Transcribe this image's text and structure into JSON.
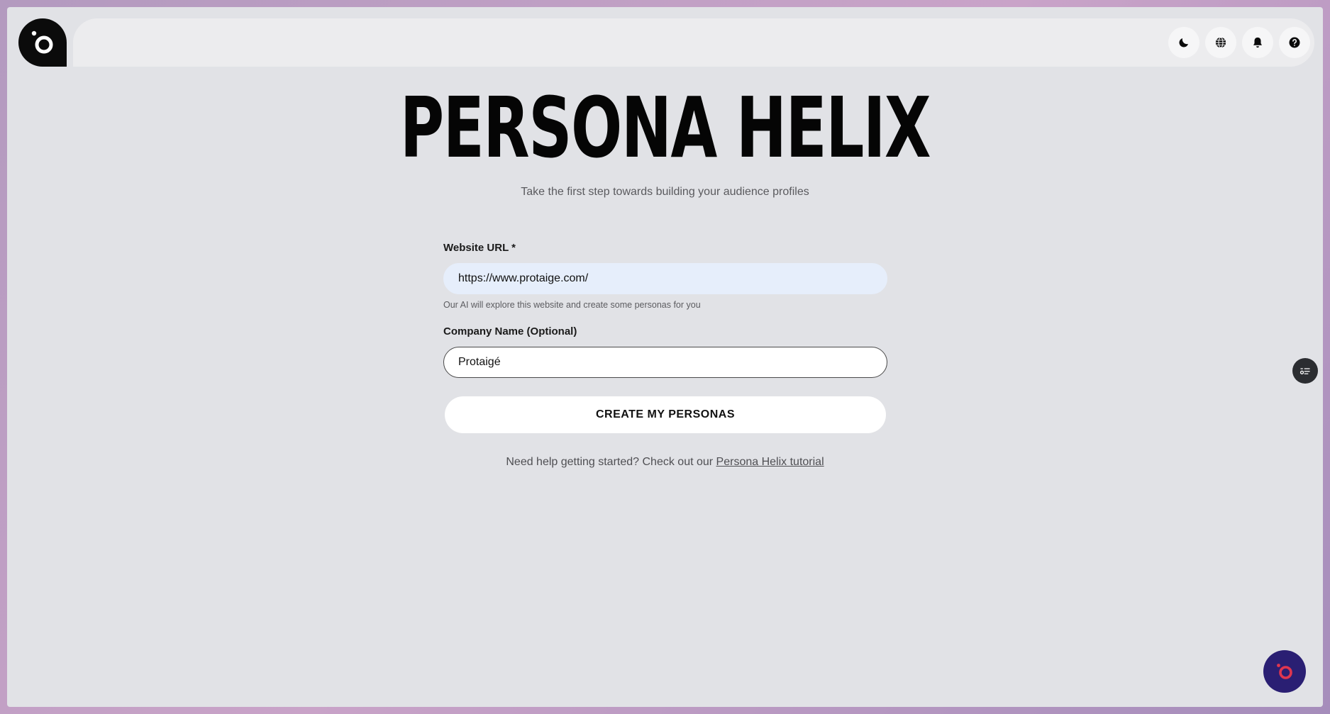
{
  "header": {
    "logo_icon": "brand-logo-icon",
    "actions": [
      {
        "name": "dark-mode-button",
        "icon": "moon-icon"
      },
      {
        "name": "language-button",
        "icon": "globe-icon"
      },
      {
        "name": "notifications-button",
        "icon": "bell-icon"
      },
      {
        "name": "help-button",
        "icon": "question-icon"
      }
    ]
  },
  "main": {
    "title": "PERSONA HELIX",
    "subtitle": "Take the first step towards building your audience profiles"
  },
  "form": {
    "website": {
      "label": "Website URL *",
      "value": "https://www.protaige.com/",
      "hint": "Our AI will explore this website and create some personas for you"
    },
    "company": {
      "label": "Company Name (Optional)",
      "value": "Protaigé"
    },
    "submit_label": "CREATE MY PERSONAS"
  },
  "footer": {
    "help_text": "Need help getting started? Check out our ",
    "help_link": "Persona Helix tutorial"
  },
  "colors": {
    "background": "#e1e2e6",
    "logo": "#0b0b0b",
    "url_field": "#e6eefb",
    "chat_button": "#2a1f73",
    "chat_accent": "#e0364f"
  }
}
